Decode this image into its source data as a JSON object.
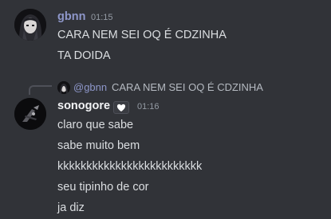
{
  "messages": [
    {
      "author": "gbnn",
      "author_color": "#8e97ca",
      "time": "01:15",
      "avatar_icon": "anime-girl-avatar",
      "lines": [
        "CARA NEM SEI OQ É CDZINHA",
        "TA DOIDA"
      ]
    },
    {
      "reply_to": {
        "author": "@gbnn",
        "text": "CARA NEM SEI OQ É CDZINHA",
        "avatar_icon": "anime-girl-avatar"
      },
      "author": "sonogore",
      "author_color": "#f2f3f5",
      "badge_icon": "white-heart-icon",
      "time": "01:16",
      "avatar_icon": "dark-figure-avatar",
      "lines": [
        "claro que sabe",
        "sabe muito bem",
        "kkkkkkkkkkkkkkkkkkkkkkkkk",
        "seu tipinho de cor",
        "ja diz"
      ]
    }
  ]
}
